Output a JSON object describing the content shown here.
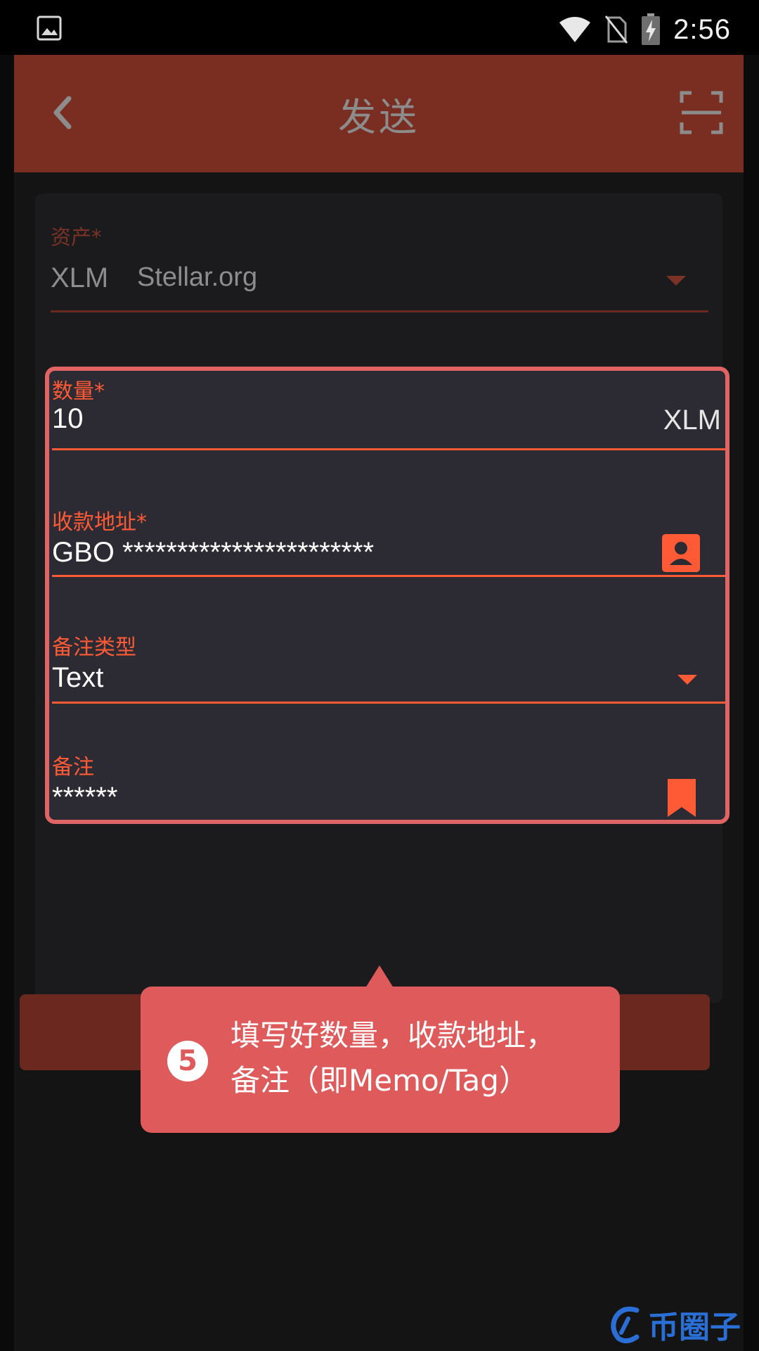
{
  "status_bar": {
    "time": "2:56",
    "icons": [
      "gallery-icon",
      "wifi-icon",
      "no-sim-icon",
      "battery-charging-icon"
    ]
  },
  "toolbar": {
    "title": "发送",
    "back_icon": "chevron-left-icon",
    "scan_icon": "scan-icon"
  },
  "form": {
    "asset": {
      "label": "资产*",
      "code": "XLM",
      "issuer": "Stellar.org"
    },
    "amount": {
      "label": "数量*",
      "value": "10",
      "unit": "XLM"
    },
    "address": {
      "label": "收款地址*",
      "value": "GBO ***********************",
      "icon": "contact-icon"
    },
    "memo_type": {
      "label": "备注类型",
      "value": "Text"
    },
    "memo": {
      "label": "备注",
      "value": "******",
      "icon": "bookmark-icon"
    }
  },
  "tooltip": {
    "step": "5",
    "text_line1": "填写好数量，收款地址，",
    "text_line2": "备注（即Memo/Tag）"
  },
  "watermark": {
    "text": "币圈子"
  },
  "colors": {
    "accent": "#ff5a36",
    "toolbar": "#7a2e21",
    "tooltip": "#df5b5b",
    "highlight_border": "#e06464"
  }
}
